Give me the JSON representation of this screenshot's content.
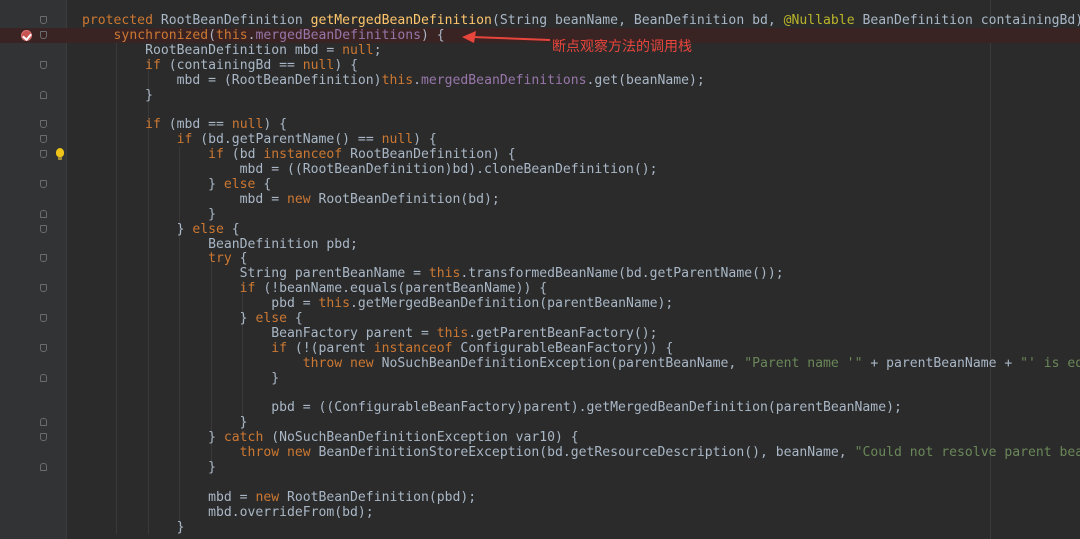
{
  "editor": {
    "lines": [
      {
        "tokens": [
          {
            "t": "protected ",
            "c": "kw"
          },
          {
            "t": "RootBeanDefinition "
          },
          {
            "t": "getMergedBeanDefinition",
            "c": "fn"
          },
          {
            "t": "(String beanName, BeanDefinition bd, "
          },
          {
            "t": "@Nullable",
            "c": "ann"
          },
          {
            "t": " BeanDefinition containingBd) {"
          }
        ]
      },
      {
        "tokens": [
          {
            "t": "    "
          },
          {
            "t": "synchronized",
            "c": "kw"
          },
          {
            "t": "("
          },
          {
            "t": "this",
            "c": "kw"
          },
          {
            "t": "."
          },
          {
            "t": "mergedBeanDefinitions",
            "c": "fld"
          },
          {
            "t": ") {"
          }
        ]
      },
      {
        "tokens": [
          {
            "t": "        RootBeanDefinition mbd = "
          },
          {
            "t": "null",
            "c": "kw"
          },
          {
            "t": ";"
          }
        ]
      },
      {
        "tokens": [
          {
            "t": "        "
          },
          {
            "t": "if",
            "c": "kw"
          },
          {
            "t": " (containingBd == "
          },
          {
            "t": "null",
            "c": "kw"
          },
          {
            "t": ") {"
          }
        ]
      },
      {
        "tokens": [
          {
            "t": "            mbd = (RootBeanDefinition)"
          },
          {
            "t": "this",
            "c": "kw"
          },
          {
            "t": "."
          },
          {
            "t": "mergedBeanDefinitions",
            "c": "fld"
          },
          {
            "t": ".get(beanName);"
          }
        ]
      },
      {
        "tokens": [
          {
            "t": "        }"
          }
        ]
      },
      {
        "tokens": []
      },
      {
        "tokens": [
          {
            "t": "        "
          },
          {
            "t": "if",
            "c": "kw"
          },
          {
            "t": " (mbd == "
          },
          {
            "t": "null",
            "c": "kw"
          },
          {
            "t": ") {"
          }
        ]
      },
      {
        "tokens": [
          {
            "t": "            "
          },
          {
            "t": "if",
            "c": "kw"
          },
          {
            "t": " (bd.getParentName() == "
          },
          {
            "t": "null",
            "c": "kw"
          },
          {
            "t": ") {"
          }
        ]
      },
      {
        "tokens": [
          {
            "t": "                "
          },
          {
            "t": "if",
            "c": "kw"
          },
          {
            "t": " (bd "
          },
          {
            "t": "instanceof",
            "c": "kw"
          },
          {
            "t": " RootBeanDefinition) {"
          }
        ]
      },
      {
        "tokens": [
          {
            "t": "                    mbd = ((RootBeanDefinition)bd).cloneBeanDefinition();"
          }
        ]
      },
      {
        "tokens": [
          {
            "t": "                } "
          },
          {
            "t": "else",
            "c": "kw"
          },
          {
            "t": " {"
          }
        ]
      },
      {
        "tokens": [
          {
            "t": "                    mbd = "
          },
          {
            "t": "new",
            "c": "kw"
          },
          {
            "t": " RootBeanDefinition(bd);"
          }
        ]
      },
      {
        "tokens": [
          {
            "t": "                }"
          }
        ]
      },
      {
        "tokens": [
          {
            "t": "            } "
          },
          {
            "t": "else",
            "c": "kw"
          },
          {
            "t": " {"
          }
        ]
      },
      {
        "tokens": [
          {
            "t": "                BeanDefinition pbd;"
          }
        ]
      },
      {
        "tokens": [
          {
            "t": "                "
          },
          {
            "t": "try",
            "c": "kw"
          },
          {
            "t": " {"
          }
        ]
      },
      {
        "tokens": [
          {
            "t": "                    String parentBeanName = "
          },
          {
            "t": "this",
            "c": "kw"
          },
          {
            "t": ".transformedBeanName(bd.getParentName());"
          }
        ]
      },
      {
        "tokens": [
          {
            "t": "                    "
          },
          {
            "t": "if",
            "c": "kw"
          },
          {
            "t": " (!beanName.equals(parentBeanName)) {"
          }
        ]
      },
      {
        "tokens": [
          {
            "t": "                        pbd = "
          },
          {
            "t": "this",
            "c": "kw"
          },
          {
            "t": ".getMergedBeanDefinition(parentBeanName);"
          }
        ]
      },
      {
        "tokens": [
          {
            "t": "                    } "
          },
          {
            "t": "else",
            "c": "kw"
          },
          {
            "t": " {"
          }
        ]
      },
      {
        "tokens": [
          {
            "t": "                        BeanFactory parent = "
          },
          {
            "t": "this",
            "c": "kw"
          },
          {
            "t": ".getParentBeanFactory();"
          }
        ]
      },
      {
        "tokens": [
          {
            "t": "                        "
          },
          {
            "t": "if",
            "c": "kw"
          },
          {
            "t": " (!(parent "
          },
          {
            "t": "instanceof",
            "c": "kw"
          },
          {
            "t": " ConfigurableBeanFactory)) {"
          }
        ]
      },
      {
        "tokens": [
          {
            "t": "                            "
          },
          {
            "t": "throw new",
            "c": "kw"
          },
          {
            "t": " NoSuchBeanDefinitionException(parentBeanName, "
          },
          {
            "t": "\"Parent name '\"",
            "c": "str"
          },
          {
            "t": " + parentBeanName + "
          },
          {
            "t": "\"' is equ",
            "c": "str"
          }
        ]
      },
      {
        "tokens": [
          {
            "t": "                        }"
          }
        ]
      },
      {
        "tokens": []
      },
      {
        "tokens": [
          {
            "t": "                        pbd = ((ConfigurableBeanFactory)parent).getMergedBeanDefinition(parentBeanName);"
          }
        ]
      },
      {
        "tokens": [
          {
            "t": "                    }"
          }
        ]
      },
      {
        "tokens": [
          {
            "t": "                } "
          },
          {
            "t": "catch",
            "c": "kw"
          },
          {
            "t": " (NoSuchBeanDefinitionException var10) {"
          }
        ]
      },
      {
        "tokens": [
          {
            "t": "                    "
          },
          {
            "t": "throw new",
            "c": "kw"
          },
          {
            "t": " BeanDefinitionStoreException(bd.getResourceDescription(), beanName, "
          },
          {
            "t": "\"Could not resolve parent bean",
            "c": "str"
          }
        ]
      },
      {
        "tokens": [
          {
            "t": "                }"
          }
        ]
      },
      {
        "tokens": []
      },
      {
        "tokens": [
          {
            "t": "                mbd = "
          },
          {
            "t": "new",
            "c": "kw"
          },
          {
            "t": " RootBeanDefinition(pbd);"
          }
        ]
      },
      {
        "tokens": [
          {
            "t": "                mbd.overrideFrom(bd);"
          }
        ]
      },
      {
        "tokens": [
          {
            "t": "            }"
          }
        ]
      }
    ]
  },
  "gutter": {
    "breakpoint_icon": "breakpoint-icon",
    "intention_icon": "lightbulb-icon",
    "fold_icon": "fold-marker-icon"
  },
  "annotation": {
    "text": "断点观察方法的调用栈",
    "color": "#e8453c"
  },
  "colors": {
    "background": "#2b2b2b",
    "keyword": "#cc7832",
    "method": "#ffc66d",
    "field": "#9876aa",
    "string": "#6a8759",
    "annotation": "#bbb529",
    "text": "#a9b7c6"
  }
}
